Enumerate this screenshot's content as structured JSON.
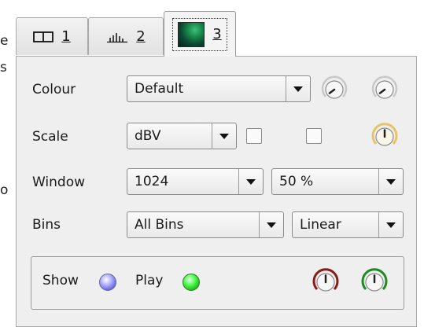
{
  "edge_text": {
    "top": "e",
    "second": "s",
    "middle": "o"
  },
  "tabs": [
    {
      "id": "t1",
      "label": "1",
      "icon": "split-view-icon"
    },
    {
      "id": "t2",
      "label": "2",
      "icon": "histogram-icon"
    },
    {
      "id": "t3",
      "label": "3",
      "icon": "spectrogram-thumbnail-icon",
      "selected": true
    }
  ],
  "rows": {
    "colour": {
      "label": "Colour",
      "value": "Default"
    },
    "scale": {
      "label": "Scale",
      "value": "dBV"
    },
    "window": {
      "label": "Window",
      "value": "1024",
      "overlap": "50 %"
    },
    "bins": {
      "label": "Bins",
      "value": "All Bins",
      "freq_scale": "Linear"
    }
  },
  "group": {
    "show_label": "Show",
    "play_label": "Play"
  },
  "colors": {
    "knob_gold_arc": "#e8c468",
    "knob_red_arc": "#8b1a1a",
    "knob_green_arc": "#1f8a1f",
    "led_show": "#5a5ad8",
    "led_play": "#11b311"
  }
}
